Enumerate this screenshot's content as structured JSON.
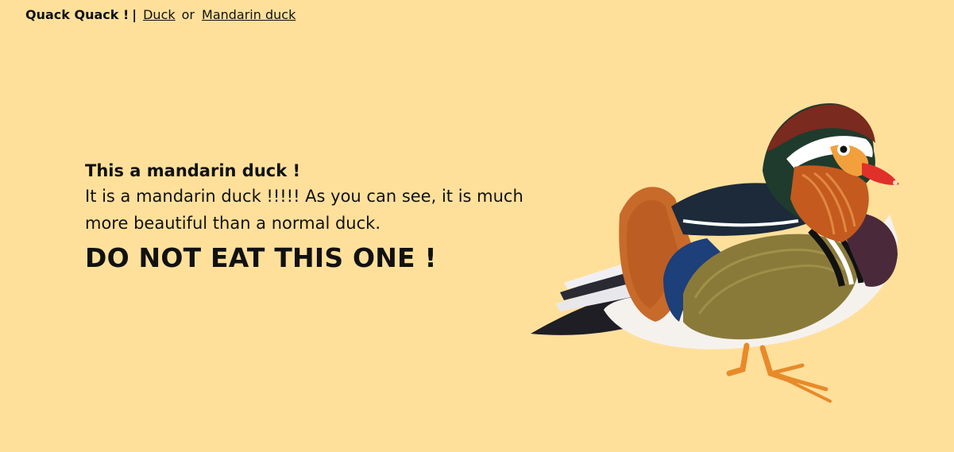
{
  "nav": {
    "brand": "Quack Quack !",
    "separator": "|",
    "link_duck": "Duck",
    "or_text": "or",
    "link_mandarin": "Mandarin duck"
  },
  "main": {
    "subtitle": "This a mandarin duck !",
    "description": "It is a mandarin duck !!!!! As you can see, it is much more beautiful than a normal duck.",
    "warning": "DO NOT EAT THIS ONE !"
  },
  "image": {
    "subject": "mandarin-duck"
  },
  "colors": {
    "background": "#ffe09b",
    "text": "#111111"
  }
}
